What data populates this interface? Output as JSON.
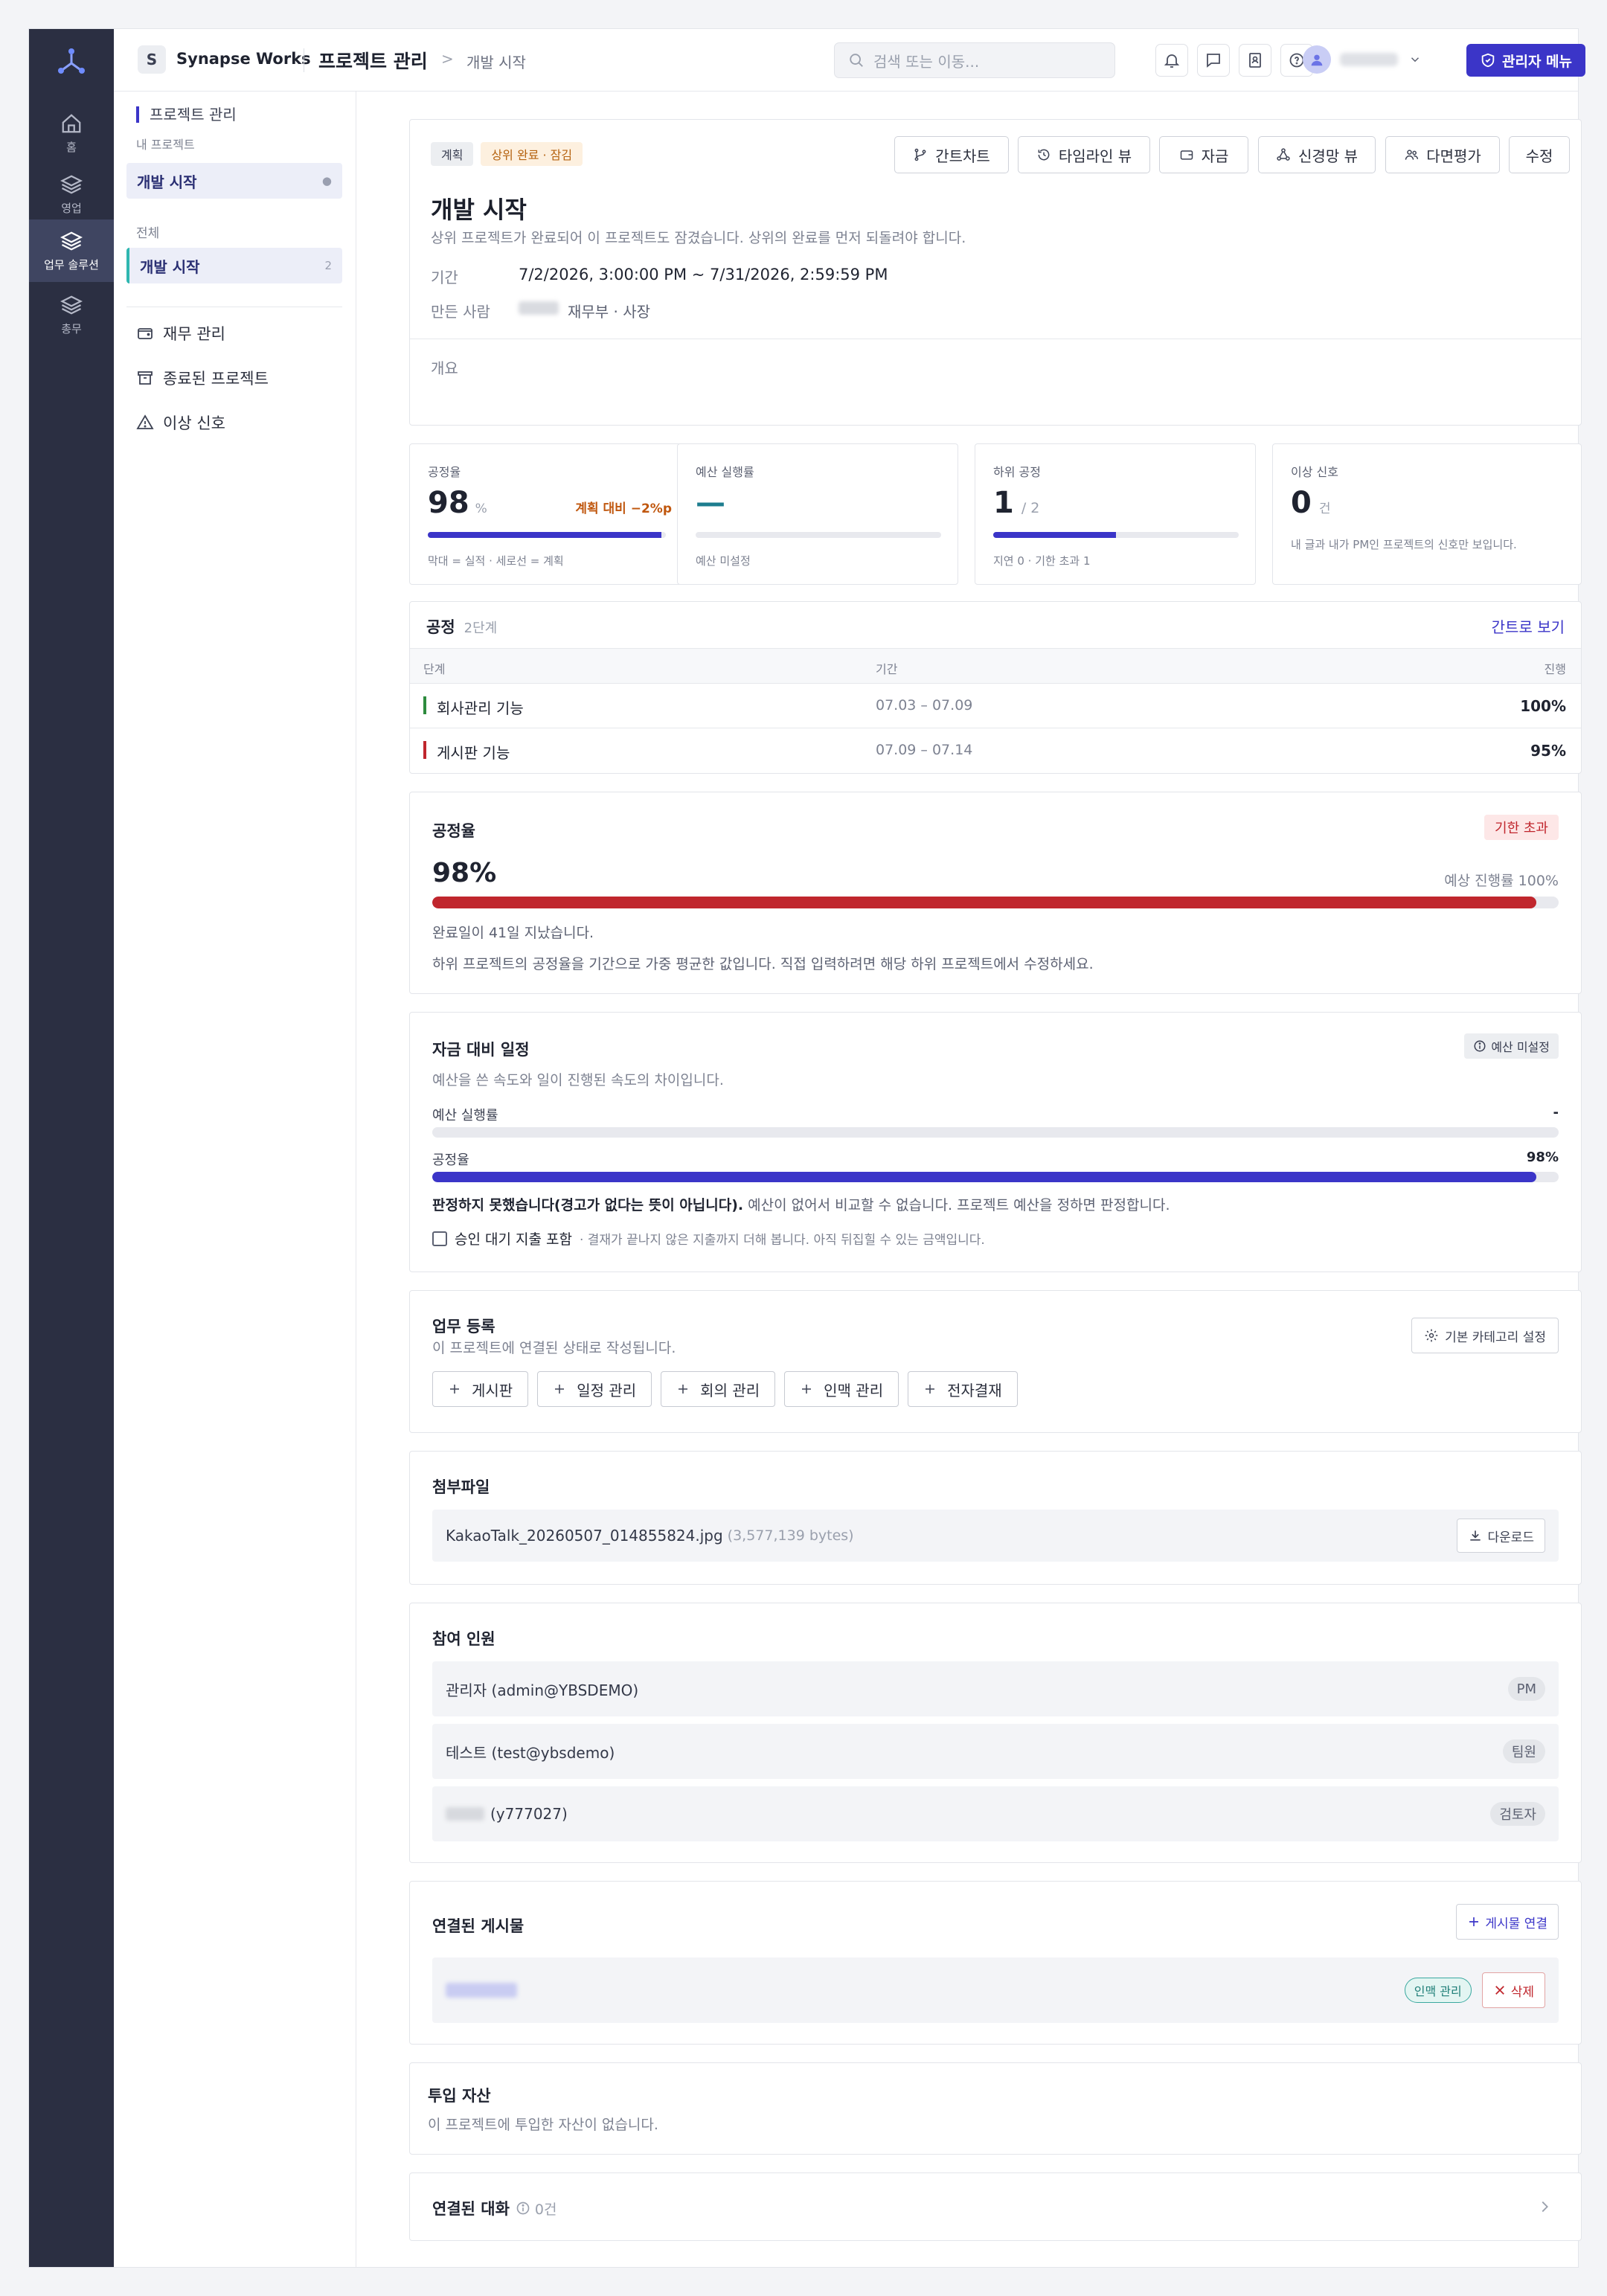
{
  "app": {
    "workspace_badge": "S",
    "workspace_name": "Synapse Works"
  },
  "rail": {
    "items": [
      {
        "label": "홈",
        "icon": "home-icon"
      },
      {
        "label": "영업",
        "icon": "layers-icon"
      },
      {
        "label": "업무 솔루션",
        "icon": "layers-icon"
      },
      {
        "label": "총무",
        "icon": "layers-icon"
      }
    ]
  },
  "topbar": {
    "breadcrumb_main": "프로젝트 관리",
    "breadcrumb_sep": ">",
    "breadcrumb_current": "개발 시작",
    "search_placeholder": "검색 또는 이동...",
    "admin_label": "관리자 메뉴"
  },
  "sidebar": {
    "header": "프로젝트 관리",
    "sub": "내 프로젝트",
    "my_selected": "개발 시작",
    "all_label": "전체",
    "all_selected": "개발 시작",
    "all_count": "2",
    "links": [
      "재무 관리",
      "종료된 프로젝트",
      "이상 신호"
    ]
  },
  "project": {
    "status": "계획",
    "lock_chip": "상위 완료 · 잠김",
    "title": "개발 시작",
    "lock_msg": "상위 프로젝트가 완료되어 이 프로젝트도 잠겼습니다. 상위의 완료를 먼저 되돌려야 합니다.",
    "period_label": "기간",
    "period": "7/2/2026, 3:00:00 PM ~ 7/31/2026, 2:59:59 PM",
    "creator_label": "만든 사람",
    "creator_role": "재무부 · 사장",
    "overview_label": "개요",
    "actions": [
      "간트차트",
      "타임라인 뷰",
      "자금",
      "신경망 뷰",
      "다면평가",
      "수정"
    ]
  },
  "metrics": {
    "progress": {
      "label": "공정율",
      "value": "98",
      "unit": "%",
      "delta": "계획 대비 −2%p",
      "legend": "막대 = 실적 · 세로선 = 계획",
      "fraction": 0.98
    },
    "budget": {
      "label": "예산 실행률",
      "value": "—",
      "note": "예산 미설정"
    },
    "sub": {
      "label": "하위 공정",
      "value": "1",
      "total": "/ 2",
      "note": "지연 0 · 기한 초과 1",
      "fraction": 0.5
    },
    "alert": {
      "label": "이상 신호",
      "value": "0",
      "unit": "건",
      "note": "내 글과 내가 PM인 프로젝트의 신호만 보입니다."
    }
  },
  "process": {
    "title": "공정",
    "count": "2단계",
    "link": "간트로 보기",
    "columns": [
      "단계",
      "기간",
      "진행"
    ],
    "rows": [
      {
        "name": "회사관리 기능",
        "period": "07.03 – 07.09",
        "progress": "100%",
        "color": "#2e8b3e"
      },
      {
        "name": "게시판 기능",
        "period": "07.09 – 07.14",
        "progress": "95%",
        "color": "#c0262d"
      }
    ]
  },
  "rate": {
    "title": "공정율",
    "badge": "기한 초과",
    "value": "98%",
    "expected": "예상 진행률 100%",
    "fraction": 0.98,
    "msg1": "완료일이 41일 지났습니다.",
    "msg2": "하위 프로젝트의 공정율을 기간으로 가중 평균한 값입니다. 직접 입력하려면 해당 하위 프로젝트에서 수정하세요."
  },
  "funding": {
    "title": "자금 대비 일정",
    "badge": "예산 미설정",
    "desc": "예산을 쓴 속도와 일이 진행된 속도의 차이입니다.",
    "budget_label": "예산 실행률",
    "budget_value": "-",
    "progress_label": "공정율",
    "progress_value": "98%",
    "progress_fraction": 0.98,
    "verdict_bold": "판정하지 못했습니다(경고가 없다는 뜻이 아닙니다).",
    "verdict_rest": " 예산이 없어서 비교할 수 없습니다. 프로젝트 예산을 정하면 판정합니다.",
    "checkbox_label": "승인 대기 지출 포함",
    "checkbox_note": "· 결재가 끝나지 않은 지출까지 더해 봅니다. 아직 뒤집힐 수 있는 금액입니다."
  },
  "tasks": {
    "title": "업무 등록",
    "desc": "이 프로젝트에 연결된 상태로 작성됩니다.",
    "settings": "기본 카테고리 설정",
    "buttons": [
      "게시판",
      "일정 관리",
      "회의 관리",
      "인맥 관리",
      "전자결재"
    ]
  },
  "attachments": {
    "title": "첨부파일",
    "file": "KakaoTalk_20260507_014855824.jpg",
    "size": "(3,577,139 bytes)",
    "download": "다운로드"
  },
  "members": {
    "title": "참여 인원",
    "list": [
      {
        "name": "관리자 (admin@YBSDEMO)",
        "role": "PM"
      },
      {
        "name": "테스트 (test@ybsdemo)",
        "role": "팀원"
      },
      {
        "name": "(y777027)",
        "role": "검토자"
      }
    ]
  },
  "linked": {
    "title": "연결된 게시물",
    "add": "게시물 연결",
    "tag": "인맥 관리",
    "delete": "삭제"
  },
  "assets": {
    "title": "투입 자산",
    "desc": "이 프로젝트에 투입한 자산이 없습니다."
  },
  "chats": {
    "title": "연결된 대화",
    "count": "0건"
  },
  "colors": {
    "accent": "#3b35c8",
    "rail": "#2b2f42",
    "danger": "#c0262d",
    "warning": "#c0570e"
  }
}
